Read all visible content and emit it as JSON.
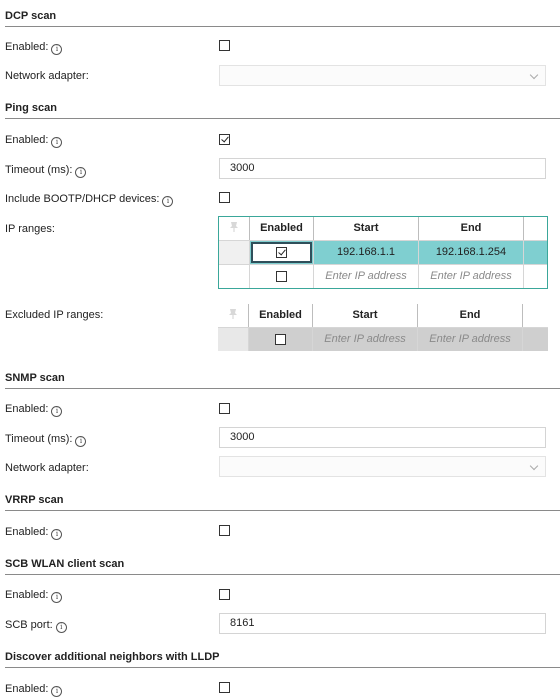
{
  "dcp": {
    "title": "DCP scan",
    "enabled_label": "Enabled:",
    "enabled": false,
    "adapter_label": "Network adapter:",
    "adapter_value": ""
  },
  "ping": {
    "title": "Ping scan",
    "enabled_label": "Enabled:",
    "enabled": true,
    "timeout_label": "Timeout (ms):",
    "timeout_value": "3000",
    "bootp_label": "Include BOOTP/DHCP devices:",
    "bootp": false,
    "ip_ranges_label": "IP ranges:",
    "excluded_label": "Excluded IP ranges:"
  },
  "table_headers": {
    "enabled": "Enabled",
    "start": "Start",
    "end": "End"
  },
  "ip_ranges": {
    "rows": [
      {
        "enabled": true,
        "start": "192.168.1.1",
        "end": "192.168.1.254"
      },
      {
        "enabled": false,
        "start": "Enter IP address",
        "end": "Enter IP address"
      }
    ]
  },
  "excluded_ranges": {
    "rows": [
      {
        "enabled": false,
        "start": "Enter IP address",
        "end": "Enter IP address"
      }
    ]
  },
  "snmp": {
    "title": "SNMP scan",
    "enabled_label": "Enabled:",
    "enabled": false,
    "timeout_label": "Timeout (ms):",
    "timeout_value": "3000",
    "adapter_label": "Network adapter:",
    "adapter_value": ""
  },
  "vrrp": {
    "title": "VRRP scan",
    "enabled_label": "Enabled:",
    "enabled": false
  },
  "scb": {
    "title": "SCB WLAN client scan",
    "enabled_label": "Enabled:",
    "enabled": false,
    "port_label": "SCB port:",
    "port_value": "8161"
  },
  "lldp": {
    "title": "Discover additional neighbors with LLDP",
    "enabled_label": "Enabled:",
    "enabled": false
  },
  "icons": {
    "info": "info-icon",
    "pin": "pin-icon",
    "dropdown": "chevron-down-icon"
  },
  "colors": {
    "accent": "#3aa79a",
    "selected_row": "#7fcfd0",
    "divider": "#8a8a8a"
  }
}
